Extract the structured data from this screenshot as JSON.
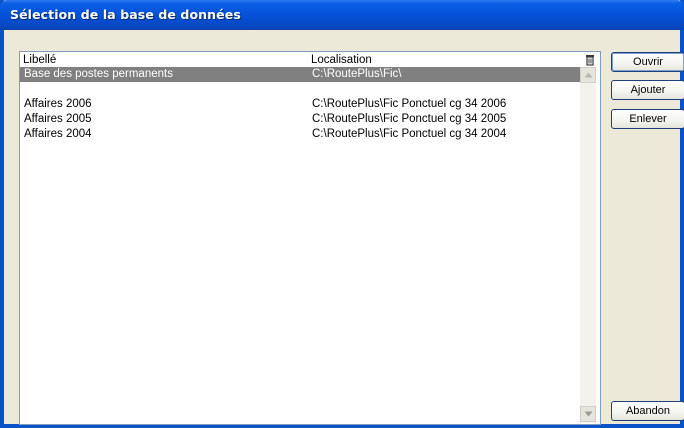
{
  "window": {
    "title": "Sélection de la base de données"
  },
  "list": {
    "columns": [
      "Libellé",
      "Localisation"
    ],
    "rows": [
      {
        "label": "Base des postes permanents",
        "location": "C:\\RoutePlus\\Fic\\",
        "selected": true
      },
      {
        "label": "",
        "location": "",
        "selected": false
      },
      {
        "label": "Affaires 2006",
        "location": "C:\\RoutePlus\\Fic Ponctuel cg 34 2006",
        "selected": false
      },
      {
        "label": "Affaires 2005",
        "location": "C:\\RoutePlus\\Fic Ponctuel cg 34 2005",
        "selected": false
      },
      {
        "label": "Affaires 2004",
        "location": "C:\\RoutePlus\\Fic Ponctuel cg 34 2004",
        "selected": false
      }
    ]
  },
  "buttons": {
    "open": "Ouvrir",
    "add": "Ajouter",
    "remove": "Enlever",
    "cancel": "Abandon"
  },
  "icons": {
    "header": "delete-icon",
    "scroll_up": "scroll-up-arrow-icon",
    "scroll_down": "scroll-down-arrow-icon"
  },
  "colors": {
    "titlebar": "#0551d8",
    "selection": "#808080",
    "background": "#ece9d8"
  }
}
